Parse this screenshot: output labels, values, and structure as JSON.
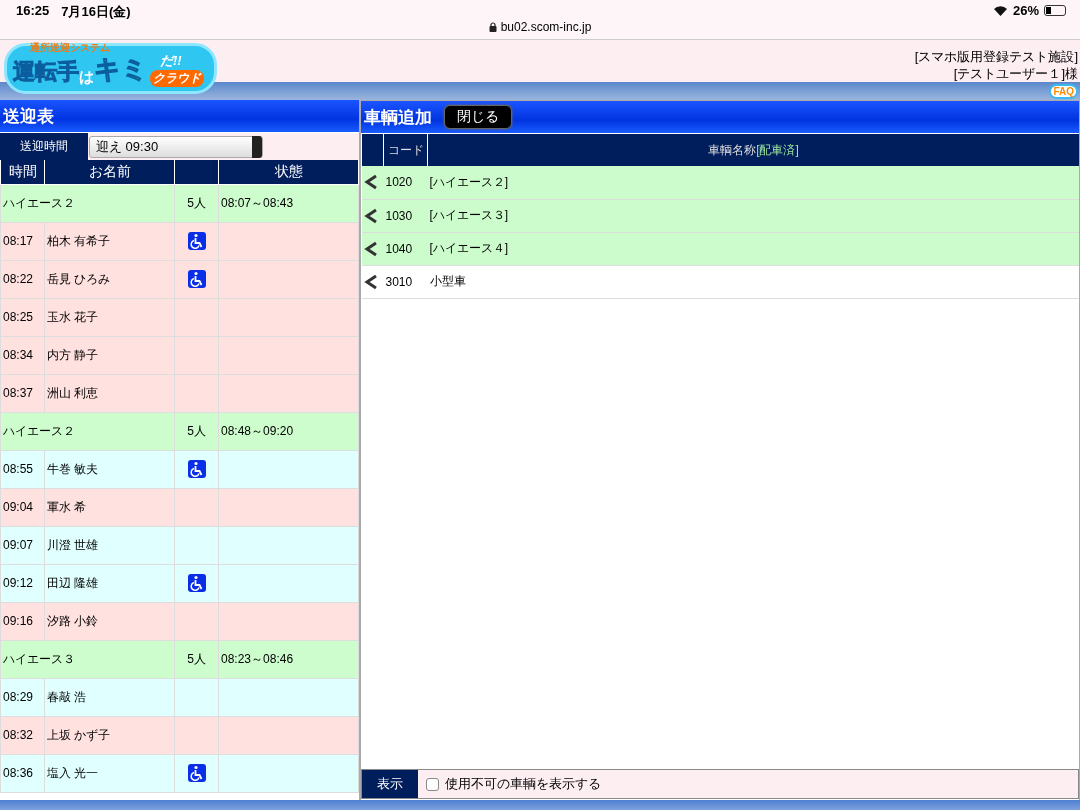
{
  "status_bar": {
    "time": "16:25",
    "date": "7月16日(金)",
    "url": "bu02.scom-inc.jp",
    "battery": "26%"
  },
  "logo": {
    "tagline": "通所送迎システム",
    "parts": [
      {
        "text": "運転手",
        "kind": "big"
      },
      {
        "text": "は",
        "kind": "small"
      },
      {
        "text": "キミ",
        "kind": "accent"
      }
    ],
    "exclaim": "だ!!",
    "cloud": "クラウド"
  },
  "user": {
    "facility": "[スマホ版用登録テスト施設]",
    "name": "[テストユーザー１]様"
  },
  "faq": "FAQ",
  "left_panel": {
    "title": "送迎表",
    "time_label": "送迎時間",
    "time_value": "迎え 09:30",
    "columns": [
      "時間",
      "お名前",
      "",
      "状態"
    ],
    "rows": [
      {
        "kind": "vehicle",
        "name": "ハイエース２",
        "count": "5人",
        "span": "08:07～08:43"
      },
      {
        "kind": "person",
        "time": "08:17",
        "name": "柏木 有希子",
        "wheelchair": true,
        "color": "#ffe1df"
      },
      {
        "kind": "person",
        "time": "08:22",
        "name": "岳見 ひろみ",
        "wheelchair": true,
        "color": "#ffe1df"
      },
      {
        "kind": "person",
        "time": "08:25",
        "name": "玉水 花子",
        "wheelchair": false,
        "color": "#ffe1df"
      },
      {
        "kind": "person",
        "time": "08:34",
        "name": "内方 静子",
        "wheelchair": false,
        "color": "#ffe1df"
      },
      {
        "kind": "person",
        "time": "08:37",
        "name": "洲山 利恵",
        "wheelchair": false,
        "color": "#ffe1df"
      },
      {
        "kind": "vehicle",
        "name": "ハイエース２",
        "count": "5人",
        "span": "08:48～09:20"
      },
      {
        "kind": "person",
        "time": "08:55",
        "name": "牛巻 敏夫",
        "wheelchair": true,
        "color": "#e0ffff"
      },
      {
        "kind": "person",
        "time": "09:04",
        "name": "軍水 希",
        "wheelchair": false,
        "color": "#ffe1df"
      },
      {
        "kind": "person",
        "time": "09:07",
        "name": "川澄 世雄",
        "wheelchair": false,
        "color": "#e0ffff"
      },
      {
        "kind": "person",
        "time": "09:12",
        "name": "田辺 隆雄",
        "wheelchair": true,
        "color": "#e0ffff"
      },
      {
        "kind": "person",
        "time": "09:16",
        "name": "汐路 小鈴",
        "wheelchair": false,
        "color": "#ffe1df"
      },
      {
        "kind": "vehicle",
        "name": "ハイエース３",
        "count": "5人",
        "span": "08:23～08:46"
      },
      {
        "kind": "person",
        "time": "08:29",
        "name": "春敲 浩",
        "wheelchair": false,
        "color": "#e0ffff"
      },
      {
        "kind": "person",
        "time": "08:32",
        "name": "上坂 かず子",
        "wheelchair": false,
        "color": "#ffe1df"
      },
      {
        "kind": "person",
        "time": "08:36",
        "name": "塩入 光一",
        "wheelchair": true,
        "color": "#e0ffff"
      }
    ]
  },
  "right_panel": {
    "title": "車輌追加",
    "close_button": "閉じる",
    "columns": [
      {
        "text": "コード"
      },
      {
        "text": "車輌名称",
        "suffix": "[配車済]"
      }
    ],
    "rows": [
      {
        "code": "1020",
        "name": "[ハイエース２]",
        "assigned": true
      },
      {
        "code": "1030",
        "name": "[ハイエース３]",
        "assigned": true
      },
      {
        "code": "1040",
        "name": "[ハイエース４]",
        "assigned": true
      },
      {
        "code": "3010",
        "name": "小型車",
        "assigned": false
      }
    ],
    "footer": {
      "label": "表示",
      "checkbox_label": "使用不可の車輌を表示する",
      "checked": false
    }
  }
}
